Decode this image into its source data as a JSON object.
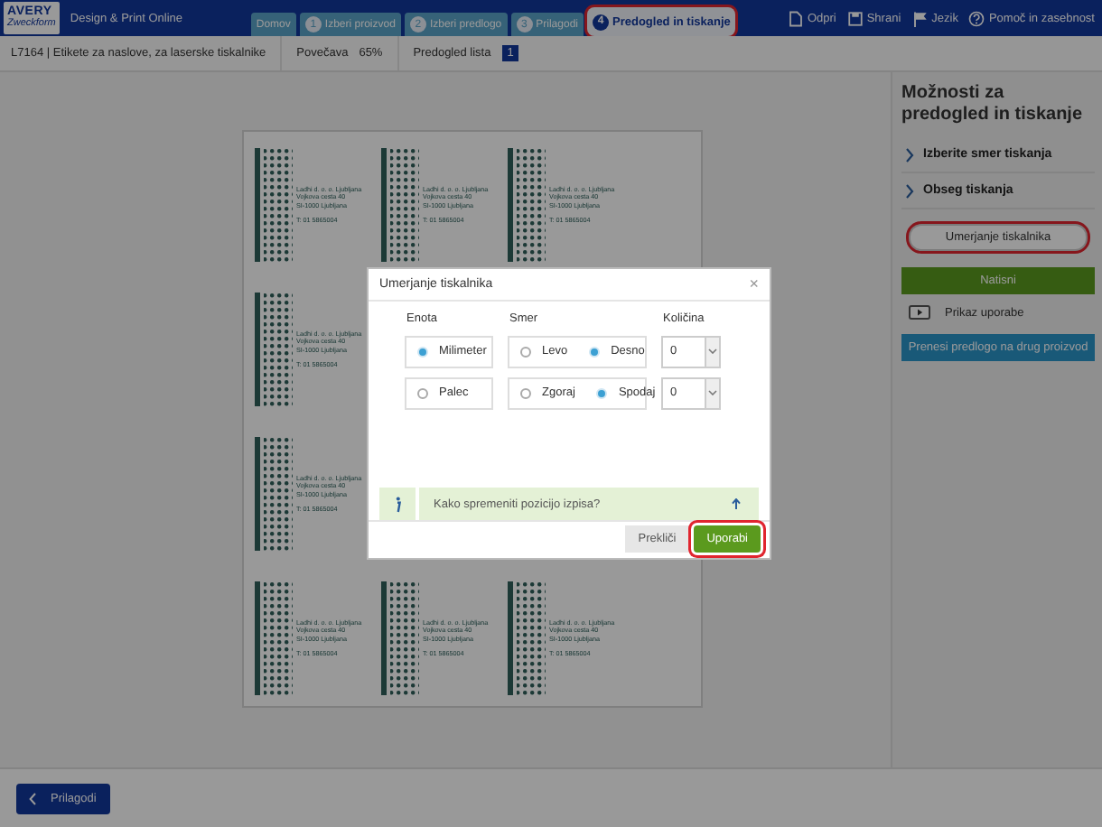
{
  "header": {
    "logo": [
      "AVERY",
      "Zweckform"
    ],
    "product_line": "Design & Print Online",
    "tabs": [
      {
        "label": "Domov",
        "selected": false
      },
      {
        "number": "1",
        "label": "Izberi proizvod",
        "selected": false
      },
      {
        "number": "2",
        "label": "Izberi predlogo",
        "selected": false
      },
      {
        "number": "3",
        "label": "Prilagodi",
        "selected": false
      },
      {
        "number": "4",
        "label": "Predogled in tiskanje",
        "selected": true,
        "highlighted": true
      }
    ],
    "actions": [
      {
        "kind": "open",
        "label": "Odpri"
      },
      {
        "kind": "save",
        "label": "Shrani"
      },
      {
        "kind": "language",
        "label": "Jezik"
      },
      {
        "kind": "help",
        "label": "Pomoč in zasebnost"
      }
    ]
  },
  "info_bar": {
    "product": "L7164 | Etikete za naslove, za laserske tiskalnike",
    "zoom_label": "Povečava",
    "zoom_value": "65%",
    "sheet_label": "Predogled lista",
    "sheet_value": "1"
  },
  "sheet": {
    "rows": [
      [
        {
          "lines": [
            "Ladhi d. o. o. Ljubljana",
            "Vojkova cesta 40",
            "SI-1000 Ljubljana"
          ],
          "phone": "T: 01 5865004"
        },
        {
          "lines": [
            "Ladhi d. o. o. Ljubljana",
            "Vojkova cesta 40",
            "SI-1000 Ljubljana"
          ],
          "phone": "T: 01 5865004"
        },
        {
          "lines": [
            "Ladhi d. o. o. Ljubljana",
            "Vojkova cesta 40",
            "SI-1000 Ljubljana"
          ],
          "phone": "T: 01 5865004"
        }
      ],
      [
        {
          "lines": [
            "Ladhi d. o. o. Ljubljana",
            "Vojkova cesta 40",
            "SI-1000 Ljubljana"
          ],
          "phone": "T: 01 5865004"
        }
      ],
      [
        {
          "lines": [
            "Ladhi d. o. o. Ljubljana",
            "Vojkova cesta 40",
            "SI-1000 Ljubljana"
          ],
          "phone": "T: 01 5865004"
        }
      ],
      [
        {
          "lines": [
            "Ladhi d. o. o. Ljubljana",
            "Vojkova cesta 40",
            "SI-1000 Ljubljana"
          ],
          "phone": "T: 01 5865004"
        },
        {
          "lines": [
            "Ladhi d. o. o. Ljubljana",
            "Vojkova cesta 40",
            "SI-1000 Ljubljana"
          ],
          "phone": "T: 01 5865004"
        },
        {
          "lines": [
            "Ladhi d. o. o. Ljubljana",
            "Vojkova cesta 40",
            "SI-1000 Ljubljana"
          ],
          "phone": "T: 01 5865004"
        }
      ]
    ]
  },
  "sidebar": {
    "title": "Možnosti za predogled in tiskanje",
    "sections": [
      "Izberite smer tiskanja",
      "Obseg tiskanja"
    ],
    "calibrate_button": {
      "label": "Umerjanje tiskalnika",
      "highlighted": true
    },
    "print_button": "Natisni",
    "video_link": "Prikaz uporabe",
    "transfer_button": "Prenesi predlogo na drug proizvod"
  },
  "footer": {
    "back_button": "Prilagodi"
  },
  "dialog": {
    "title": "Umerjanje tiskalnika",
    "close": "×",
    "unit_heading": "Enota",
    "direction_heading": "Smer",
    "amount_heading": "Količina",
    "units": [
      {
        "label": "Milimeter",
        "selected": true
      },
      {
        "label": "Palec",
        "selected": false
      }
    ],
    "directions": [
      [
        {
          "label": "Levo",
          "selected": false
        },
        {
          "label": "Desno",
          "selected": true
        }
      ],
      [
        {
          "label": "Zgoraj",
          "selected": false
        },
        {
          "label": "Spodaj",
          "selected": true
        }
      ]
    ],
    "amounts": [
      "0",
      "0"
    ],
    "help_text": "Kako spremeniti pozicijo izpisa?",
    "buttons": [
      {
        "kind": "secondary",
        "label": "Prekliči",
        "highlighted": false
      },
      {
        "kind": "primary",
        "label": "Uporabi",
        "highlighted": true
      }
    ]
  }
}
